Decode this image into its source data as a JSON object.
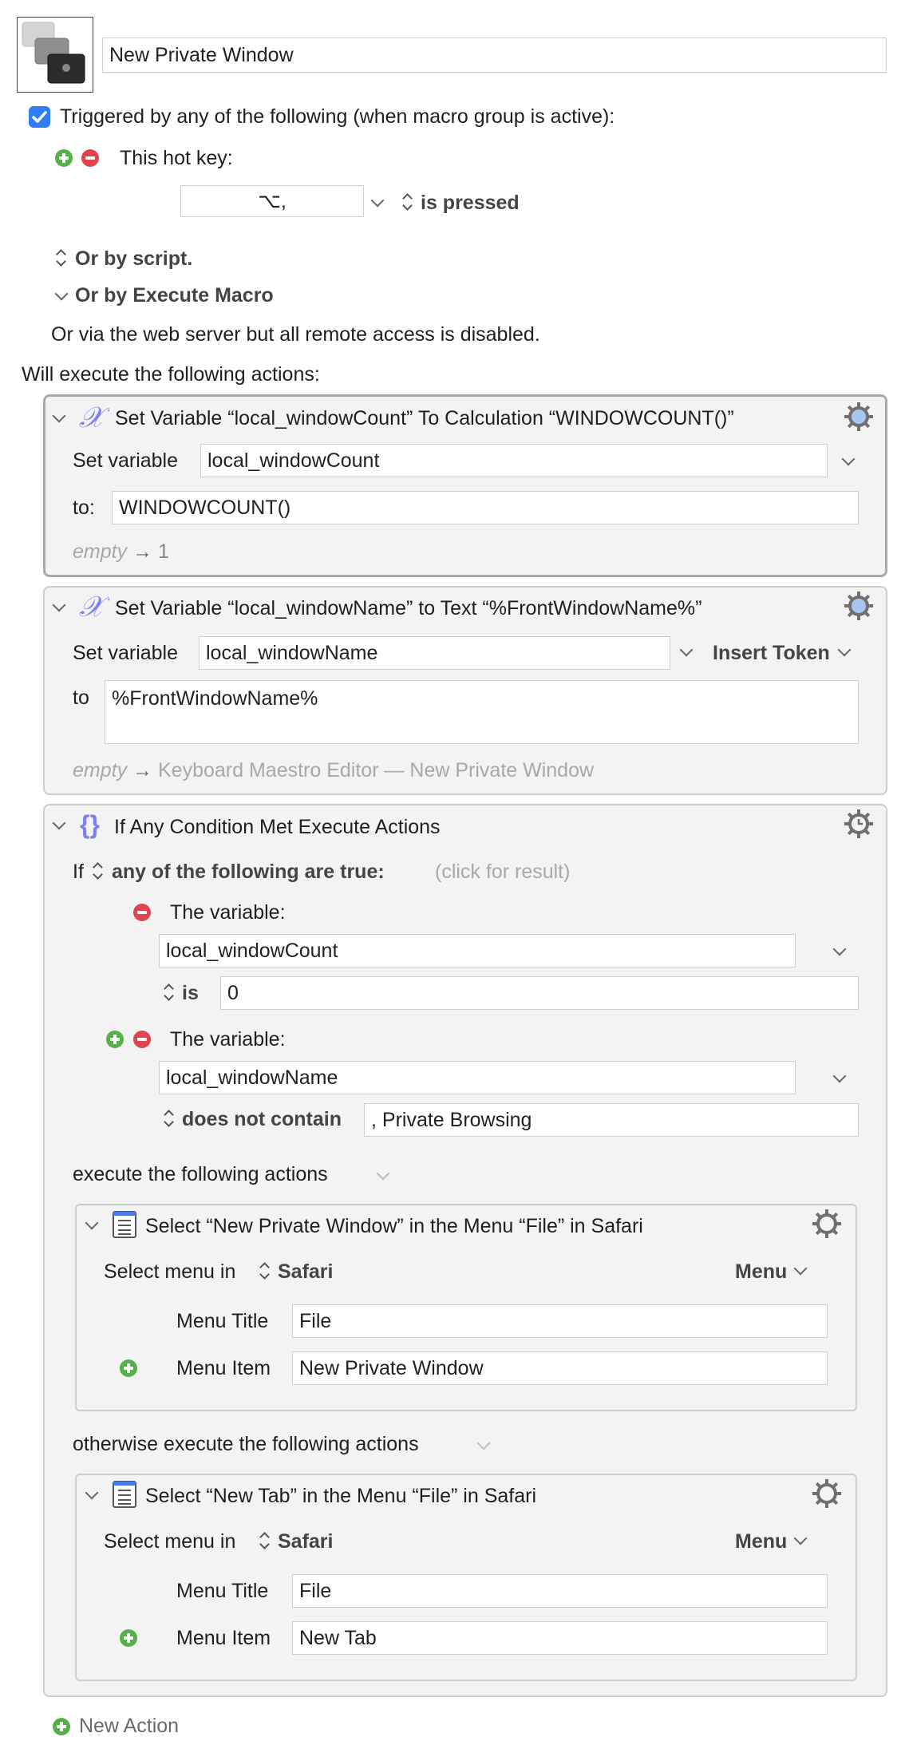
{
  "macro": {
    "name": "New Private Window",
    "triggered_label": "Triggered by any of the following (when macro group is active):",
    "hotkey_label": "This hot key:",
    "hotkey_value": "⌥,",
    "hotkey_state": "is pressed",
    "by_script": "Or by script.",
    "by_execute": "Or by Execute Macro",
    "web_server": "Or via the web server but all remote access is disabled.",
    "will_execute": "Will execute the following actions:"
  },
  "action1": {
    "title": "Set Variable “local_windowCount” To Calculation “WINDOWCOUNT()”",
    "set_label": "Set variable",
    "variable": "local_windowCount",
    "to_label": "to:",
    "calc": "WINDOWCOUNT()",
    "result_empty": "empty",
    "result_value": "1"
  },
  "action2": {
    "title": "Set Variable “local_windowName” to Text “%FrontWindowName%”",
    "set_label": "Set variable",
    "variable": "local_windowName",
    "insert_token": "Insert Token",
    "to_label": "to",
    "text": "%FrontWindowName%",
    "result_empty": "empty",
    "result_value": "Keyboard Maestro Editor — New Private Window"
  },
  "action3": {
    "title": "If Any Condition Met Execute Actions",
    "if_label": "If",
    "condition_mode": "any of the following are true:",
    "click_result": "(click for result)",
    "cond1_label": "The variable:",
    "cond1_variable": "local_windowCount",
    "cond1_op": "is",
    "cond1_value": "0",
    "cond2_label": "The variable:",
    "cond2_variable": "local_windowName",
    "cond2_op": "does not contain",
    "cond2_value": ", Private Browsing",
    "execute_label": "execute the following actions",
    "otherwise_label": "otherwise execute the following actions"
  },
  "sub1": {
    "title": "Select “New Private Window” in the Menu “File” in Safari",
    "select_in": "Select menu in",
    "app": "Safari",
    "menu_btn": "Menu",
    "menu_title_label": "Menu Title",
    "menu_title": "File",
    "menu_item_label": "Menu Item",
    "menu_item": "New Private Window"
  },
  "sub2": {
    "title": "Select “New Tab” in the Menu “File” in Safari",
    "select_in": "Select menu in",
    "app": "Safari",
    "menu_btn": "Menu",
    "menu_title_label": "Menu Title",
    "menu_title": "File",
    "menu_item_label": "Menu Item",
    "menu_item": "New Tab"
  },
  "footer": {
    "new_action": "New Action"
  },
  "colors": {
    "checkbox": "#2f7ef6",
    "add": "#55b04a",
    "remove": "#e0454e",
    "variable_icon": "#7b7ff0"
  }
}
